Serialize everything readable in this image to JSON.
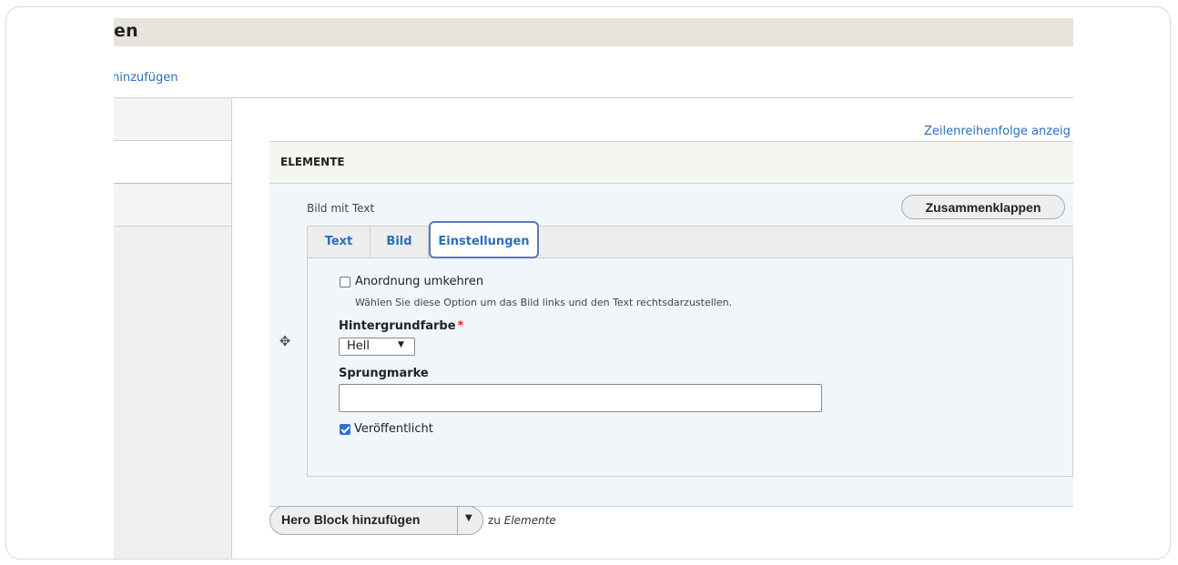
{
  "page": {
    "title_fragment": "en",
    "add_link_fragment": "ninzufügen",
    "row_order_link": "Zeilenreihenfolge anzeig"
  },
  "table": {
    "header": "ELEMENTE"
  },
  "paragraph": {
    "type_label": "Bild mit Text",
    "collapse_label": "Zusammenklappen",
    "tabs": [
      {
        "label": "Text",
        "active": false
      },
      {
        "label": "Bild",
        "active": false
      },
      {
        "label": "Einstellungen",
        "active": true
      }
    ],
    "settings": {
      "reverse_checkbox": {
        "label": "Anordnung umkehren",
        "checked": false,
        "description": "Wählen Sie diese Option um das Bild links und den Text rechtsdarzustellen."
      },
      "background": {
        "label": "Hintergrundfarbe",
        "required_marker": "*",
        "selected": "Hell"
      },
      "anchor": {
        "label": "Sprungmarke",
        "value": ""
      },
      "published": {
        "label": "Veröffentlicht",
        "checked": true
      }
    }
  },
  "footer": {
    "add_button_label": "Hero Block hinzufügen",
    "zu_prefix": "zu",
    "zu_target": "Elemente"
  },
  "icons": {
    "drag": "move-arrows-icon",
    "dropdown": "caret-down-icon"
  },
  "colors": {
    "link": "#2a6ebb",
    "required": "#e22222",
    "active_tab_outline": "#5b79b8",
    "row_background": "#f1f6fa"
  }
}
